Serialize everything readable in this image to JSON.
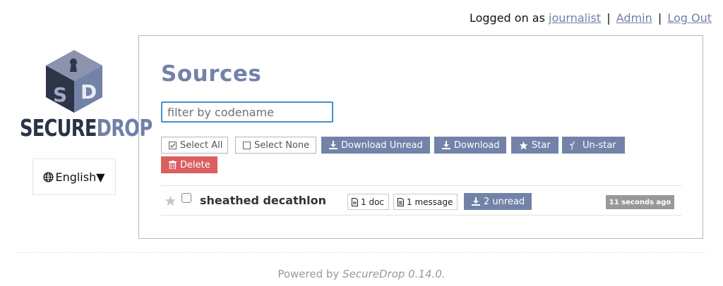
{
  "header": {
    "logged_on_prefix": "Logged on as",
    "username": "journalist",
    "sep1": "|",
    "admin": "Admin",
    "sep2": "|",
    "logout": "Log Out"
  },
  "logo": {
    "icon": "securedrop-cube-logo",
    "text_part1": "SECURE",
    "text_part2": "DROP"
  },
  "language": {
    "icon": "globe-icon",
    "label": "English▼"
  },
  "main": {
    "title": "Sources",
    "filter_placeholder": "filter by codename",
    "toolbar": {
      "select_all": "Select All",
      "select_none": "Select None",
      "download_unread": "Download Unread",
      "download": "Download",
      "star": "Star",
      "unstar": "Un-star",
      "delete": "Delete"
    },
    "sources": [
      {
        "codename": "sheathed decathlon",
        "docs": "1 doc",
        "messages": "1 message",
        "unread": "2 unread",
        "last_updated": "11 seconds ago",
        "starred": false,
        "checked": false
      }
    ]
  },
  "footer": {
    "powered_by": "Powered by",
    "product": "SecureDrop 0.14.0."
  },
  "colors": {
    "accent": "#7382a8",
    "danger": "#da5f5f",
    "link": "#7080a8",
    "focus": "#4a90c8",
    "timestamp_badge": "#999999"
  }
}
